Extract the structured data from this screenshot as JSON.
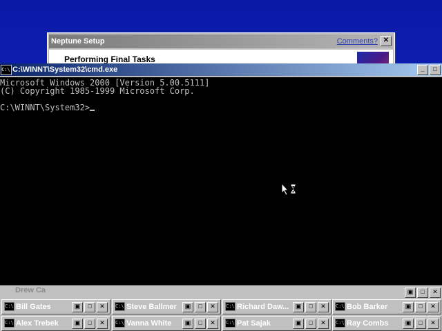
{
  "setup": {
    "title": "Neptune Setup",
    "comments_link": "Comments?",
    "close_glyph": "✕",
    "task_heading": "Performing Final Tasks"
  },
  "cmd": {
    "title": "C:\\WINNT\\System32\\cmd.exe",
    "icon_text": "C:\\",
    "buttons": {
      "minimize": "_",
      "maximize": "□"
    },
    "lines": [
      "Microsoft Windows 2000 [Version 5.00.5111]",
      "(C) Copyright 1985-1999 Microsoft Corp.",
      "",
      "C:\\WINNT\\System32>"
    ]
  },
  "strip": {
    "label": "Drew Ca"
  },
  "tasks": [
    {
      "label": "Bill Gates"
    },
    {
      "label": "Steve Ballmer"
    },
    {
      "label": "Richard Daw..."
    },
    {
      "label": "Bob Barker"
    },
    {
      "label": "Alex Trebek"
    },
    {
      "label": "Vanna White"
    },
    {
      "label": "Pat Sajak"
    },
    {
      "label": "Ray Combs"
    }
  ],
  "task_buttons": {
    "restore": "▣",
    "maximize": "□",
    "close": "✕"
  },
  "colors": {
    "desktop": "#0b1fb8",
    "active_title": "#0a246a",
    "console_bg": "#000000",
    "console_text": "#c0c0c0"
  }
}
